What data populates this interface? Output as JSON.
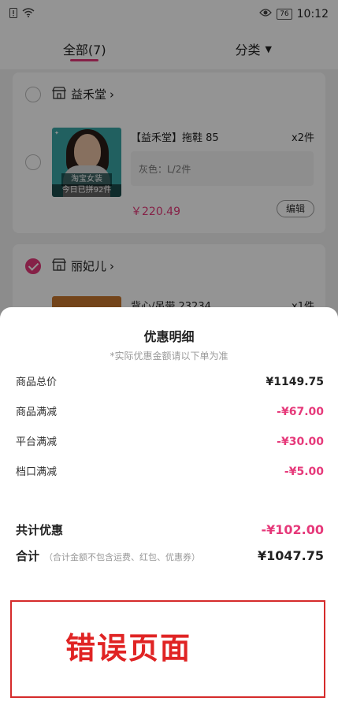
{
  "statusbar": {
    "time": "10:12",
    "battery": "76"
  },
  "tabs": [
    {
      "label": "全部(7)"
    },
    {
      "label": "分类"
    }
  ],
  "shops": [
    {
      "name": "益禾堂",
      "item": {
        "title": "【益禾堂】拖鞋 85",
        "qty": "x2件",
        "spec": "灰色：L/2件",
        "price": "￥220.49",
        "edit": "编辑",
        "thumb_badge": "淘宝女装",
        "thumb_sold": "今日已拼92件"
      }
    },
    {
      "name": "丽妃儿",
      "item": {
        "title": "背心/吊带 23234",
        "qty": "x1件"
      }
    }
  ],
  "sheet": {
    "title": "优惠明细",
    "subtitle": "*实际优惠金额请以下单为准",
    "rows": [
      {
        "label": "商品总价",
        "value": "¥1149.75"
      },
      {
        "label": "商品满减",
        "value": "-¥67.00"
      },
      {
        "label": "平台满减",
        "value": "-¥30.00"
      },
      {
        "label": "档口满减",
        "value": "-¥5.00"
      }
    ],
    "total_discount": {
      "label": "共计优惠",
      "value": "-¥102.00"
    },
    "total": {
      "label": "合计",
      "note": "（合计金额不包含运费、红包、优惠券）",
      "value": "¥1047.75"
    }
  },
  "annotation": {
    "text": "错误页面"
  },
  "colors": {
    "accent": "#e6397a",
    "error": "#e02424"
  }
}
